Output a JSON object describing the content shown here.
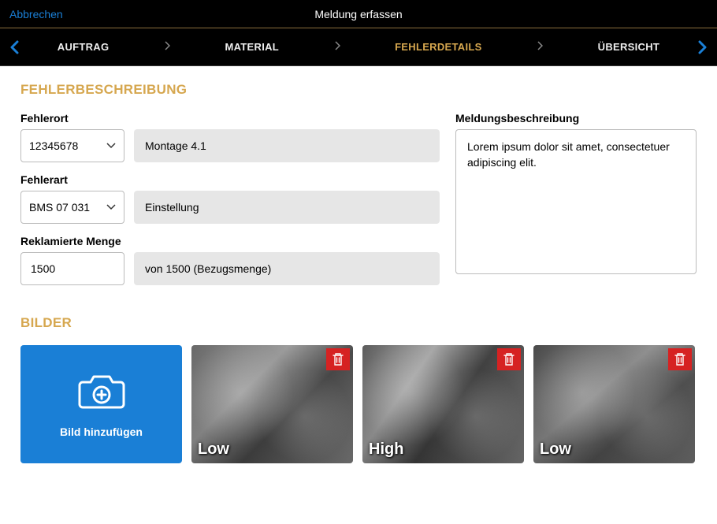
{
  "header": {
    "cancel": "Abbrechen",
    "title": "Meldung erfassen"
  },
  "nav": {
    "steps": [
      "AUFTRAG",
      "MATERIAL",
      "FEHLERDETAILS",
      "ÜBERSICHT"
    ],
    "activeIndex": 2
  },
  "sections": {
    "fehlerbeschreibung": "FEHLERBESCHREIBUNG",
    "bilder": "BILDER"
  },
  "form": {
    "fehlerort": {
      "label": "Fehlerort",
      "value": "12345678",
      "description": "Montage 4.1"
    },
    "fehlerart": {
      "label": "Fehlerart",
      "value": "BMS 07 031",
      "description": "Einstellung"
    },
    "reklamierteMenge": {
      "label": "Reklamierte Menge",
      "value": "1500",
      "description": "von 1500 (Bezugsmenge)"
    },
    "meldung": {
      "label": "Meldungsbeschreibung",
      "value": "Lorem ipsum dolor sit amet, consectetuer adipiscing elit."
    }
  },
  "images": {
    "addLabel": "Bild hinzufügen",
    "thumbs": [
      "Low",
      "High",
      "Low"
    ]
  }
}
